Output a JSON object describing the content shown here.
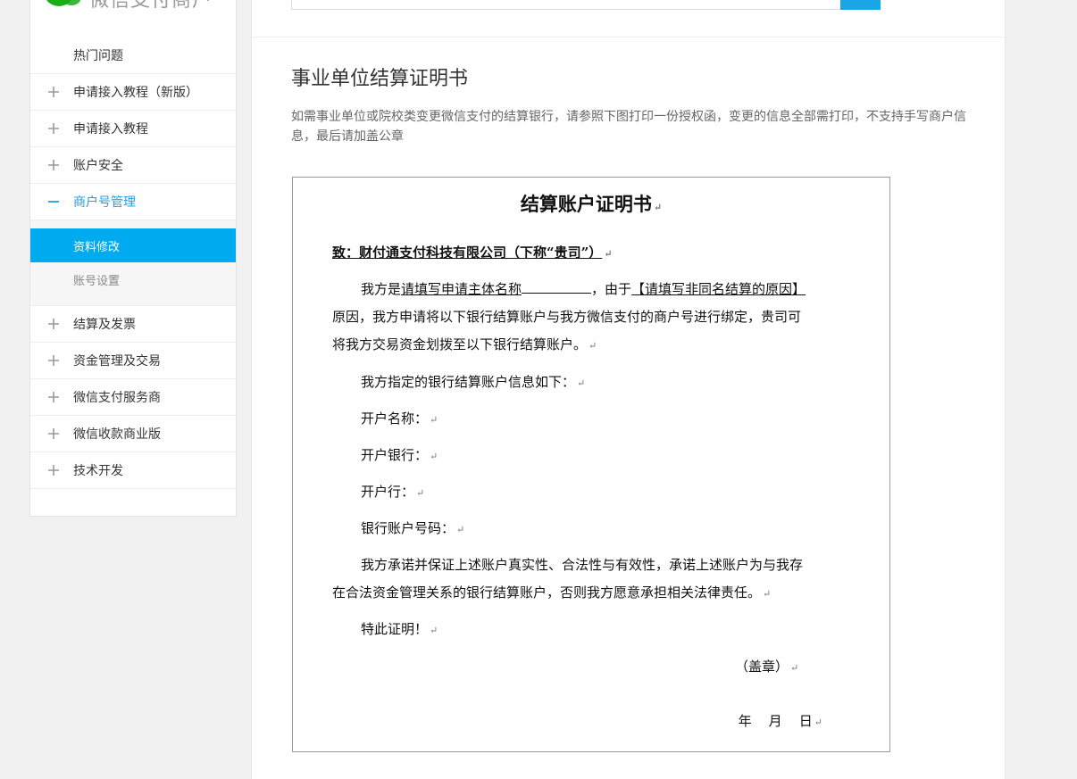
{
  "brand": {
    "name": "微信支付商户",
    "logo_icon": "wechat-pay-logo",
    "color": "#1aad19"
  },
  "sidebar": {
    "items": [
      {
        "label": "热门问题",
        "icon": "none"
      },
      {
        "label": "申请接入教程（新版）",
        "icon": "plus-icon"
      },
      {
        "label": "申请接入教程",
        "icon": "plus-icon"
      },
      {
        "label": "账户安全",
        "icon": "plus-icon"
      },
      {
        "label": "商户号管理",
        "icon": "minus-icon",
        "expanded": true
      },
      {
        "label": "结算及发票",
        "icon": "plus-icon"
      },
      {
        "label": "资金管理及交易",
        "icon": "plus-icon"
      },
      {
        "label": "微信支付服务商",
        "icon": "plus-icon"
      },
      {
        "label": "微信收款商业版",
        "icon": "plus-icon"
      },
      {
        "label": "技术开发",
        "icon": "plus-icon"
      }
    ],
    "submenu": [
      {
        "label": "资料修改",
        "active": true
      },
      {
        "label": "账号设置",
        "active": false
      }
    ],
    "accent_color": "#00aaee"
  },
  "main": {
    "title": "事业单位结算证明书",
    "description": "如需事业单位或院校类变更微信支付的结算银行，请参照下图打印一份授权函，变更的信息全部需打印，不支持手写商户信息，最后请加盖公章"
  },
  "document": {
    "title": "结算账户证明书",
    "addressee": "致：财付通支付科技有限公司（下称“贵司”）",
    "p1_a": "我方是",
    "p1_b": "请填写申请主体名称",
    "p1_c": "，由于",
    "p1_d": "【请填写非同名结算的原因】",
    "p1_line2": "原因，我方申请将以下银行结算账户与我方微信支付的商户号进行绑定，贵司可",
    "p1_line3": "将我方交易资金划拨至以下银行结算账户。",
    "p2": "我方指定的银行结算账户信息如下：",
    "field_name": "开户名称：",
    "field_bank": "开户银行：",
    "field_branch": "开户行：",
    "field_account": "银行账户号码：",
    "p3_line1": "我方承诺并保证上述账户真实性、合法性与有效性，承诺上述账户为与我存",
    "p3_line2": "在合法资金管理关系的银行结算账户，否则我方愿意承担相关法律责任。",
    "closing": "特此证明！",
    "seal": "（盖章）",
    "date": "年    月    日",
    "para_mark": "↵"
  }
}
